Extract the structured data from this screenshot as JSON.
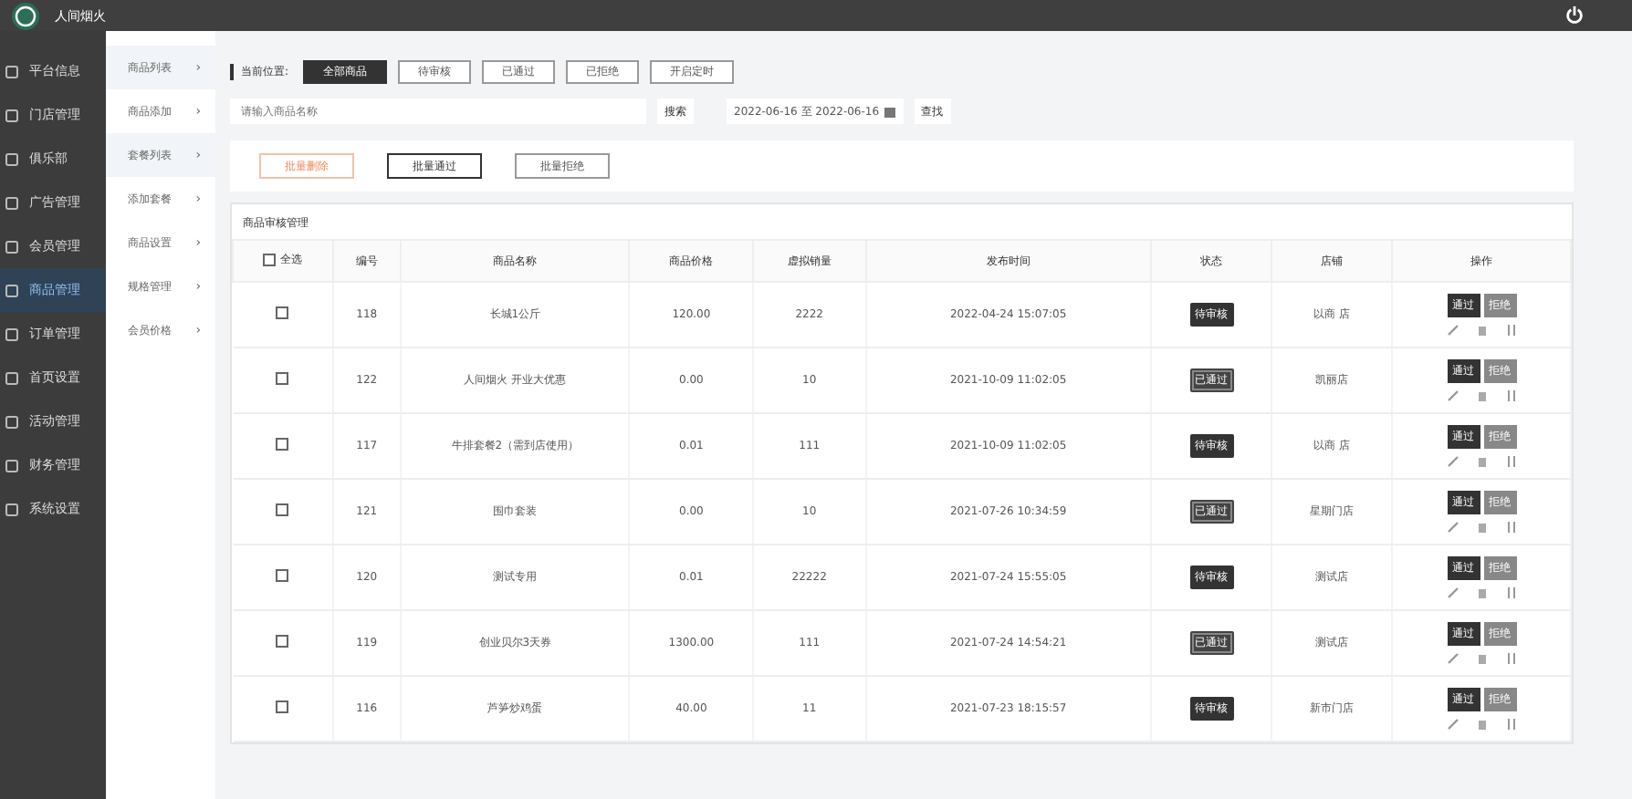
{
  "header": {
    "title": "人间烟火"
  },
  "sidebar": {
    "items": [
      {
        "label": "平台信息",
        "selected": false
      },
      {
        "label": "门店管理",
        "selected": false
      },
      {
        "label": "俱乐部",
        "selected": false
      },
      {
        "label": "广告管理",
        "selected": false
      },
      {
        "label": "会员管理",
        "selected": false
      },
      {
        "label": "商品管理",
        "selected": true
      },
      {
        "label": "订单管理",
        "selected": false
      },
      {
        "label": "首页设置",
        "selected": false
      },
      {
        "label": "活动管理",
        "selected": false
      },
      {
        "label": "财务管理",
        "selected": false
      },
      {
        "label": "系统设置",
        "selected": false
      }
    ]
  },
  "subnav": {
    "items": [
      {
        "label": "商品列表",
        "arrow": "›",
        "selected": true
      },
      {
        "label": "商品添加",
        "arrow": "›",
        "selected": false
      },
      {
        "label": "套餐列表",
        "arrow": "›",
        "selected": true
      },
      {
        "label": "添加套餐",
        "arrow": "›",
        "selected": false
      },
      {
        "label": "商品设置",
        "arrow": "›",
        "selected": false
      },
      {
        "label": "规格管理",
        "arrow": "›",
        "selected": false
      },
      {
        "label": "会员价格",
        "arrow": "›",
        "selected": false
      }
    ]
  },
  "breadcrumb": {
    "label": "当前位置:"
  },
  "tabs": [
    {
      "label": "全部商品",
      "selected": true
    },
    {
      "label": "待审核",
      "selected": false
    },
    {
      "label": "已通过",
      "selected": false
    },
    {
      "label": "已拒绝",
      "selected": false
    },
    {
      "label": "开启定时",
      "selected": false
    }
  ],
  "search": {
    "placeholder": "请输入商品名称",
    "button": "搜索"
  },
  "date_range": {
    "value": "2022-06-16 至 2022-06-16",
    "button": "查找"
  },
  "batch_buttons": [
    {
      "label": "批量删除",
      "kind": "danger"
    },
    {
      "label": "批量通过",
      "kind": "primary"
    },
    {
      "label": "批量拒绝",
      "kind": "plain"
    }
  ],
  "table": {
    "title": "商品审核管理",
    "select_all": {
      "label": "全选",
      "checked": false
    },
    "columns": [
      "编号",
      "商品名称",
      "商品价格",
      "虚拟销量",
      "发布时间",
      "状态",
      "店铺",
      "操作"
    ],
    "rows": [
      {
        "checked": false,
        "id": "118",
        "name": "长城1公斤",
        "price": "120.00",
        "sales": "2222",
        "time": "2022-04-24 15:07:05",
        "status": "待审核",
        "kind": "pending",
        "shop": "以商 店",
        "actions": [
          "通过",
          "拒绝"
        ]
      },
      {
        "checked": false,
        "id": "122",
        "name": "人间烟火 开业大优惠",
        "price": "0.00",
        "sales": "10",
        "time": "2021-10-09 11:02:05",
        "status": "已通过",
        "kind": "approved",
        "shop": "凯丽店",
        "actions": [
          "通过",
          "拒绝"
        ]
      },
      {
        "checked": false,
        "id": "117",
        "name": "牛排套餐2（需到店使用）",
        "price": "0.01",
        "sales": "111",
        "time": "2021-10-09 11:02:05",
        "status": "待审核",
        "kind": "pending",
        "shop": "以商 店",
        "actions": [
          "通过",
          "拒绝"
        ]
      },
      {
        "checked": false,
        "id": "121",
        "name": "围巾套装",
        "price": "0.00",
        "sales": "10",
        "time": "2021-07-26 10:34:59",
        "status": "已通过",
        "kind": "approved",
        "shop": "星期门店",
        "actions": [
          "通过",
          "拒绝"
        ]
      },
      {
        "checked": false,
        "id": "120",
        "name": "测试专用",
        "price": "0.01",
        "sales": "22222",
        "time": "2021-07-24 15:55:05",
        "status": "待审核",
        "kind": "pending",
        "shop": "测试店",
        "actions": [
          "通过",
          "拒绝"
        ]
      },
      {
        "checked": false,
        "id": "119",
        "name": "创业贝尔3天券",
        "price": "1300.00",
        "sales": "111",
        "time": "2021-07-24 14:54:21",
        "status": "已通过",
        "kind": "approved",
        "shop": "测试店",
        "actions": [
          "通过",
          "拒绝"
        ]
      },
      {
        "checked": false,
        "id": "116",
        "name": "芦笋炒鸡蛋",
        "price": "40.00",
        "sales": "11",
        "time": "2021-07-23 18:15:57",
        "status": "待审核",
        "kind": "pending",
        "shop": "新市门店",
        "actions": [
          "通过",
          "拒绝"
        ]
      }
    ]
  }
}
